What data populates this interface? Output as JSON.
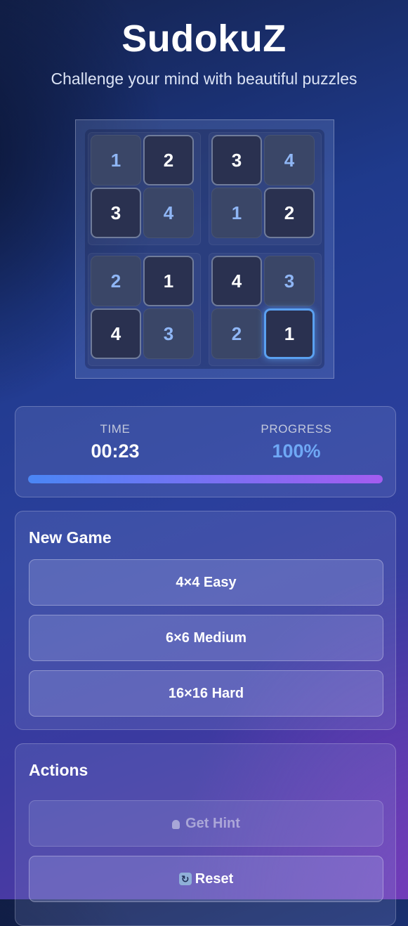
{
  "header": {
    "title": "SudokuZ",
    "subtitle": "Challenge your mind with beautiful puzzles"
  },
  "board": {
    "size": 4,
    "cells": [
      [
        {
          "value": "1",
          "given": false
        },
        {
          "value": "2",
          "given": true
        },
        {
          "value": "3",
          "given": true
        },
        {
          "value": "4",
          "given": false
        }
      ],
      [
        {
          "value": "3",
          "given": true
        },
        {
          "value": "4",
          "given": false
        },
        {
          "value": "1",
          "given": false
        },
        {
          "value": "2",
          "given": true
        }
      ],
      [
        {
          "value": "2",
          "given": false
        },
        {
          "value": "1",
          "given": true
        },
        {
          "value": "4",
          "given": true
        },
        {
          "value": "3",
          "given": false
        }
      ],
      [
        {
          "value": "4",
          "given": true
        },
        {
          "value": "3",
          "given": false
        },
        {
          "value": "2",
          "given": false
        },
        {
          "value": "1",
          "given": true
        }
      ]
    ],
    "selected": {
      "row": 3,
      "col": 3
    }
  },
  "stats": {
    "time_label": "TIME",
    "time_value": "00:23",
    "progress_label": "PROGRESS",
    "progress_value": "100%",
    "progress_fraction": 1.0
  },
  "new_game": {
    "heading": "New Game",
    "buttons": [
      "4×4 Easy",
      "6×6 Medium",
      "16×16 Hard"
    ]
  },
  "actions": {
    "heading": "Actions",
    "hint_label": "Get Hint",
    "hint_icon": "lightbulb-icon",
    "reset_label": "Reset",
    "reset_icon": "refresh-icon"
  },
  "colors": {
    "given_digit": "#ffffff",
    "user_digit": "#8fb6f5",
    "progress_value": "#6fa8f5",
    "bar_start": "#4a86f5",
    "bar_end": "#a45cf0",
    "selected_border": "#5aa0f0"
  }
}
